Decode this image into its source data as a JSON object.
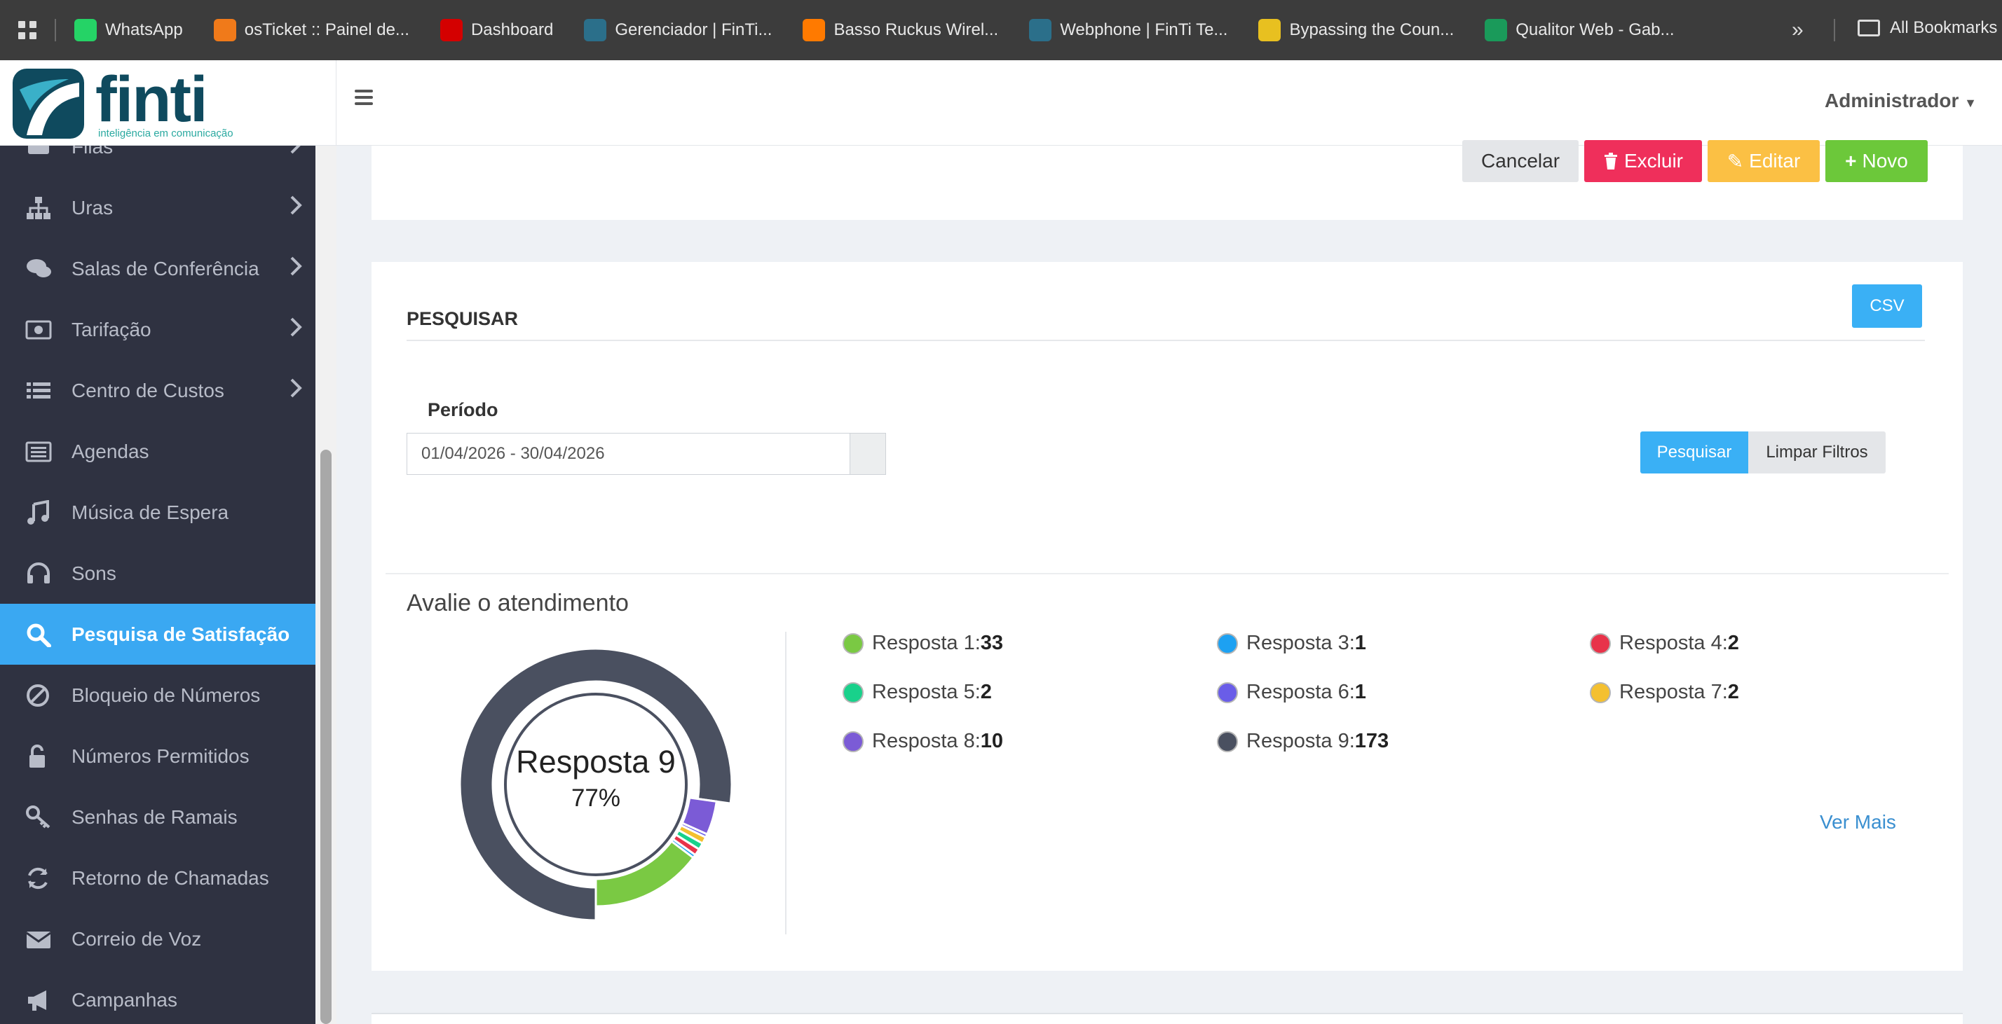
{
  "browser": {
    "bookmarks": [
      {
        "label": "WhatsApp",
        "icon": "whatsapp-icon",
        "color": "#25d366"
      },
      {
        "label": "osTicket :: Painel de...",
        "icon": "osticket-icon",
        "color": "#f07a1a"
      },
      {
        "label": "Dashboard",
        "icon": "zabbix-icon",
        "color": "#d40000"
      },
      {
        "label": "Gerenciador | FinTi...",
        "icon": "finti-icon",
        "color": "#2b6f8a"
      },
      {
        "label": "Basso Ruckus Wirel...",
        "icon": "ruckus-icon",
        "color": "#ff7a00"
      },
      {
        "label": "Webphone | FinTi Te...",
        "icon": "finti-icon",
        "color": "#2b6f8a"
      },
      {
        "label": "Bypassing the Coun...",
        "icon": "bypass-icon",
        "color": "#e8c020"
      },
      {
        "label": "Qualitor Web - Gab...",
        "icon": "qualitor-icon",
        "color": "#1a9a5a"
      }
    ],
    "all_bookmarks": "All Bookmarks"
  },
  "header": {
    "logo_text": "finti",
    "logo_tagline": "inteligência em comunicação",
    "user": "Administrador"
  },
  "sidebar": {
    "items": [
      {
        "label": "Filas",
        "icon": "queue-icon",
        "has_children": true
      },
      {
        "label": "Uras",
        "icon": "sitemap-icon",
        "has_children": true
      },
      {
        "label": "Salas de Conferência",
        "icon": "chat-icon",
        "has_children": true
      },
      {
        "label": "Tarifação",
        "icon": "money-icon",
        "has_children": true
      },
      {
        "label": "Centro de Custos",
        "icon": "list-icon",
        "has_children": true
      },
      {
        "label": "Agendas",
        "icon": "agenda-icon",
        "has_children": false
      },
      {
        "label": "Música de Espera",
        "icon": "music-icon",
        "has_children": false
      },
      {
        "label": "Sons",
        "icon": "headphones-icon",
        "has_children": false
      },
      {
        "label": "Pesquisa de Satisfação",
        "icon": "search-icon",
        "has_children": false,
        "active": true
      },
      {
        "label": "Bloqueio de Números",
        "icon": "ban-icon",
        "has_children": false
      },
      {
        "label": "Números Permitidos",
        "icon": "unlock-icon",
        "has_children": false
      },
      {
        "label": "Senhas de Ramais",
        "icon": "key-icon",
        "has_children": false
      },
      {
        "label": "Retorno de Chamadas",
        "icon": "refresh-icon",
        "has_children": false
      },
      {
        "label": "Correio de Voz",
        "icon": "envelope-icon",
        "has_children": false
      },
      {
        "label": "Campanhas",
        "icon": "bullhorn-icon",
        "has_children": false
      }
    ]
  },
  "toolbar": {
    "cancel": "Cancelar",
    "delete": "Excluir",
    "edit": "Editar",
    "new": "Novo"
  },
  "search": {
    "title": "PESQUISAR",
    "csv": "CSV",
    "period_label": "Período",
    "period_value": "01/04/2026 - 30/04/2026",
    "search_button": "Pesquisar",
    "clear_button": "Limpar Filtros"
  },
  "survey": {
    "title": "Avalie o atendimento",
    "center_label": "Resposta 9",
    "center_percent": "77%",
    "more_link": "Ver Mais",
    "responses": [
      {
        "name": "Resposta 1",
        "label": "Resposta 1: ",
        "count": "33",
        "color": "#7ac943"
      },
      {
        "name": "Resposta 3",
        "label": "Resposta 3: ",
        "count": "1",
        "color": "#1da1f2"
      },
      {
        "name": "Resposta 4",
        "label": "Resposta 4: ",
        "count": "2",
        "color": "#e8334a"
      },
      {
        "name": "Resposta 5",
        "label": "Resposta 5: ",
        "count": "2",
        "color": "#19d18b"
      },
      {
        "name": "Resposta 6",
        "label": "Resposta 6: ",
        "count": "1",
        "color": "#6a5de8"
      },
      {
        "name": "Resposta 7",
        "label": "Resposta 7: ",
        "count": "2",
        "color": "#f4c030"
      },
      {
        "name": "Resposta 8",
        "label": "Resposta 8: ",
        "count": "10",
        "color": "#7b5bd6"
      },
      {
        "name": "Resposta 9",
        "label": "Resposta 9: ",
        "count": "173",
        "color": "#4a5060"
      }
    ]
  },
  "chart_data": {
    "type": "pie",
    "title": "Avalie o atendimento",
    "categories": [
      "Resposta 1",
      "Resposta 3",
      "Resposta 4",
      "Resposta 5",
      "Resposta 6",
      "Resposta 7",
      "Resposta 8",
      "Resposta 9"
    ],
    "values": [
      33,
      1,
      2,
      2,
      1,
      2,
      10,
      173
    ],
    "colors": [
      "#7ac943",
      "#1da1f2",
      "#e8334a",
      "#19d18b",
      "#6a5de8",
      "#f4c030",
      "#7b5bd6",
      "#4a5060"
    ],
    "center_label": "Resposta 9",
    "center_value": "77%"
  }
}
